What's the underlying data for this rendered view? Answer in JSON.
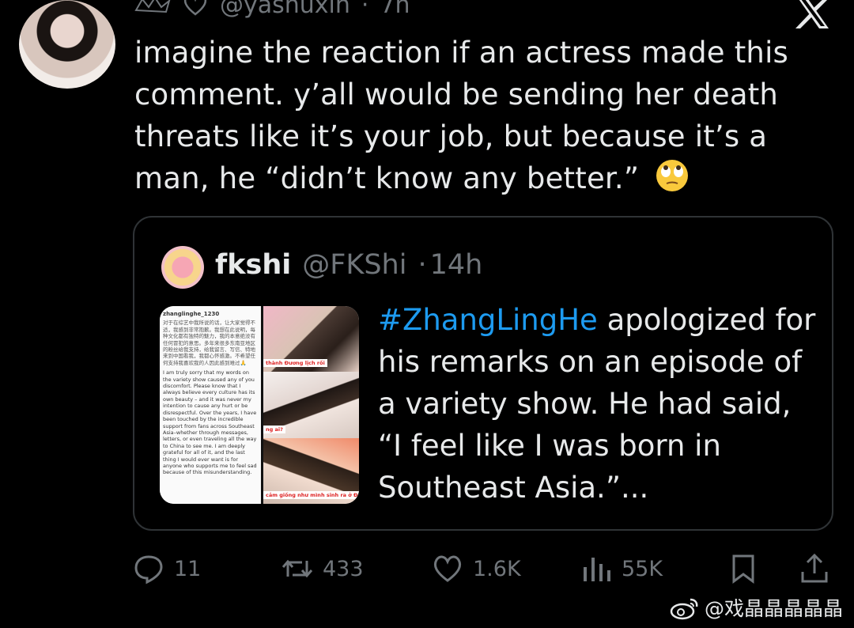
{
  "tweet": {
    "handle": "@yashuxin",
    "time": "7h",
    "text": "imagine the reaction if an actress made this comment. y’all would be sending her death threats like it’s your job, but because it’s a man, he “didn’t know any better.”",
    "emoji": "face-with-rolling-eyes"
  },
  "quote": {
    "name": "fkshi",
    "handle": "@FKShi",
    "time": "14h",
    "hashtag": "#ZhangLingHe",
    "text": " apologized for his remarks on an episode of a variety show. He had said, “I feel like I was born in Southeast Asia.”...",
    "media": {
      "note_username": "zhanglinghe_1230",
      "note_cn": "对于在综艺中我所说的话，让大家觉得不适，我感到非常抱歉。我想在此说明，每种文化都有独特的魅力，我的本意绝没有任何冒犯的意思。多年来很多东南亚地区的粉丝给我支持，给我留言、写信、特地来到中国看我，我都心怀感激。不希望任何支持我喜欢我的人因此感到难过🙏",
      "note_en": "I am truly sorry that my words on the variety show caused any of you discomfort. Please know that I always believe every culture has its own beauty – and it was never my intention to cause any hurt or be disrespectful. Over the years, I have been touched by the incredible support from fans across Southeast Asia–whether through messages, letters, or even traveling all the way to China to see me. I am deeply grateful for all of it, and the last thing I would ever want is for anyone who supports me to feel sad because of this misunderstanding.",
      "caption_1": "thành Đương lịch rồi",
      "caption_2": "ng ai?",
      "caption_3": "cảm giống như mình sinh ra ở Đông Nam Á"
    }
  },
  "actions": {
    "replies": "11",
    "reposts": "433",
    "likes": "1.6K",
    "views": "55K"
  },
  "watermark": "@戏晶晶晶晶晶"
}
